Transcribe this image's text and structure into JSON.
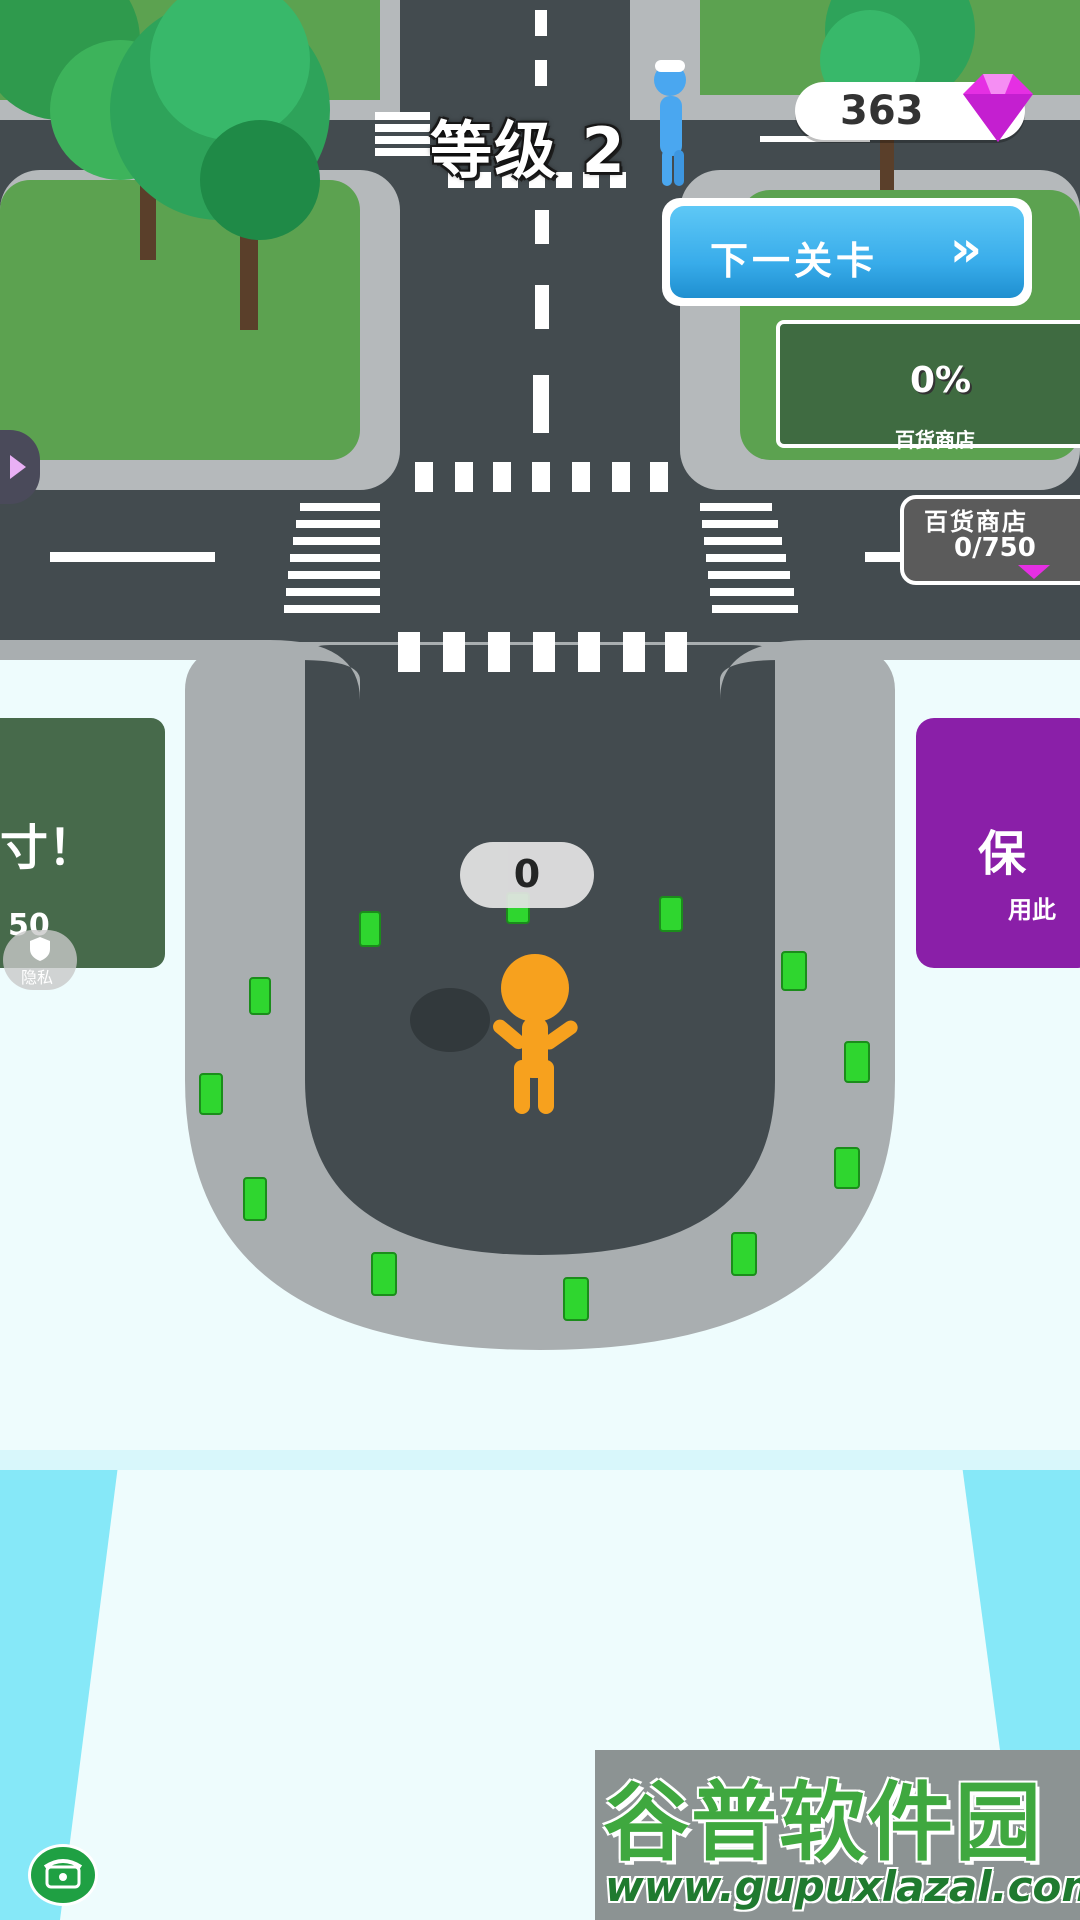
{
  "hud": {
    "level_label": "等级 2",
    "gem_count": "363",
    "next_level_button": "下一关卡",
    "next_level_arrows": "»"
  },
  "plot": {
    "progress_percent": "0%",
    "name": "百货商店"
  },
  "shop_cost": {
    "title": "百货商店",
    "value": "0/750"
  },
  "left_sign": {
    "text": "寸！",
    "price": "50"
  },
  "right_sign": {
    "text": "保",
    "sub": "用此"
  },
  "player": {
    "carried_count": "0"
  },
  "privacy_button": {
    "label": "隐私"
  },
  "watermark": {
    "title": "谷普软件园",
    "url": "www.gupuxlazal.com"
  },
  "colors": {
    "road": "#434b4f",
    "curb": "#a9aeb0",
    "grass": "#5ca250",
    "sky_ground": "#eefcfd",
    "water": "#7ee9f9",
    "player": "#f7a11e",
    "gem": "#e52fe3",
    "cash": "#2fd62f",
    "button_blue": "#38acea"
  }
}
